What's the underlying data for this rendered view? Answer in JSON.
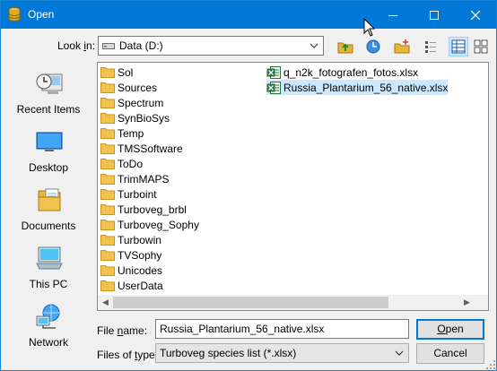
{
  "window": {
    "title": "Open",
    "controls": {
      "minimize": "minimize",
      "maximize": "maximize",
      "close": "close"
    },
    "accent": "#0078d7"
  },
  "lookin": {
    "label_prefix": "Look ",
    "label_key": "i",
    "label_suffix": "n:",
    "value": "Data (D:)"
  },
  "toolbar": {
    "icons": [
      "up-folder-icon",
      "recent-icon",
      "new-folder-icon",
      "list-view-icon",
      "details-view-icon",
      "large-icons-icon"
    ]
  },
  "places": [
    {
      "label": "Recent Items",
      "icon": "recent-items-icon"
    },
    {
      "label": "Desktop",
      "icon": "desktop-icon"
    },
    {
      "label": "Documents",
      "icon": "documents-icon"
    },
    {
      "label": "This PC",
      "icon": "this-pc-icon"
    },
    {
      "label": "Network",
      "icon": "network-icon"
    }
  ],
  "folders": [
    "Sol",
    "Sources",
    "Spectrum",
    "SynBioSys",
    "Temp",
    "TMSSoftware",
    "ToDo",
    "TrimMAPS",
    "Turboint",
    "Turboveg_brbl",
    "Turboveg_Sophy",
    "Turbowin",
    "TVSophy",
    "Unicodes",
    "UserData"
  ],
  "files": [
    {
      "name": "q_n2k_fotografen_fotos.xlsx",
      "selected": false
    },
    {
      "name": "Russia_Plantarium_56_native.xlsx",
      "selected": true
    }
  ],
  "filename": {
    "label_prefix": "File ",
    "label_key": "n",
    "label_suffix": "ame:",
    "value": "Russia_Plantarium_56_native.xlsx"
  },
  "filetype": {
    "label_prefix": "Files of ",
    "label_key": "t",
    "label_suffix": "ype:",
    "value": "Turboveg species list (*.xlsx)"
  },
  "buttons": {
    "open_key": "O",
    "open_rest": "pen",
    "cancel": "Cancel"
  }
}
